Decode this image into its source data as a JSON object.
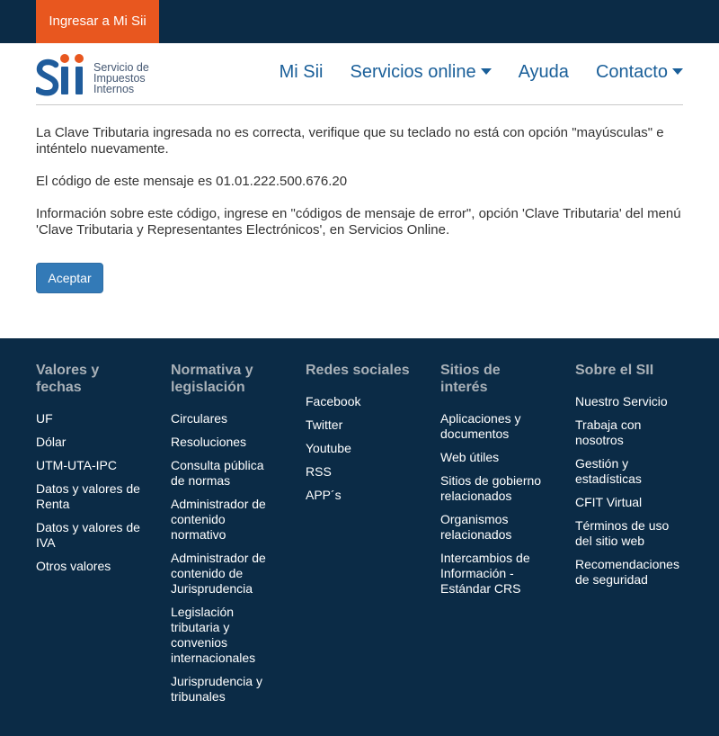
{
  "top_bar": {
    "login_button": "Ingresar a Mi Sii"
  },
  "header": {
    "logo": {
      "wordmark": "Sii",
      "text_lines": [
        "Servicio de",
        "Impuestos",
        "Internos"
      ]
    },
    "nav": [
      {
        "label": "Mi Sii",
        "dropdown": false
      },
      {
        "label": "Servicios online",
        "dropdown": true,
        "icon": "caret-down-icon"
      },
      {
        "label": "Ayuda",
        "dropdown": false
      },
      {
        "label": "Contacto",
        "dropdown": true,
        "icon": "caret-down-icon"
      }
    ]
  },
  "message": {
    "paragraphs": [
      "La Clave Tributaria ingresada no es correcta, verifique que su teclado no está con opción \"mayúsculas\" e inténtelo nuevamente.",
      "El código de este mensaje es 01.01.222.500.676.20",
      "Información sobre este código, ingrese en \"códigos de mensaje de error\", opción 'Clave Tributaria' del menú 'Clave Tributaria y Representantes Electrónicos', en Servicios Online."
    ],
    "accept_button": "Aceptar"
  },
  "footer": {
    "columns": [
      {
        "heading": "Valores y fechas",
        "links": [
          "UF",
          "Dólar",
          "UTM-UTA-IPC",
          "Datos y valores de Renta",
          "Datos y valores de IVA",
          "Otros valores"
        ]
      },
      {
        "heading": "Normativa y legislación",
        "links": [
          "Circulares",
          "Resoluciones",
          "Consulta pública de normas",
          "Administrador de contenido normativo",
          "Administrador de contenido de Jurisprudencia",
          "Legislación tributaria y convenios internacionales",
          "Jurisprudencia y tribunales"
        ]
      },
      {
        "heading": "Redes sociales",
        "links": [
          "Facebook",
          "Twitter",
          "Youtube",
          "RSS",
          "APP´s"
        ]
      },
      {
        "heading": "Sitios de interés",
        "links": [
          "Aplicaciones y documentos",
          "Web útiles",
          "Sitios de gobierno relacionados",
          "Organismos relacionados",
          "Intercambios de Información - Estándar CRS"
        ]
      },
      {
        "heading": "Sobre el SII",
        "links": [
          "Nuestro Servicio",
          "Trabaja con nosotros",
          "Gestión y estadísticas",
          "CFIT Virtual",
          "Términos de uso del sitio web",
          "Recomendaciones de seguridad"
        ]
      }
    ]
  },
  "colors": {
    "top_bar_bg": "#0b2b46",
    "login_button_bg": "#e8571f",
    "logo_blue": "#1f5c9c",
    "logo_orange": "#e8571f",
    "nav_text": "#1a5f99",
    "body_text": "#333333",
    "accept_button_bg": "#337ab7",
    "footer_bg": "#0b2b46",
    "footer_heading": "#a9b1b8",
    "footer_link": "#ffffff"
  }
}
